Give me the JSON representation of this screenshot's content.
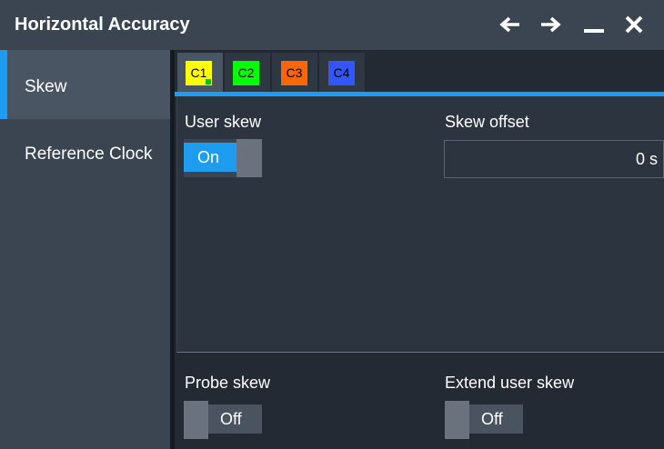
{
  "window": {
    "title": "Horizontal Accuracy",
    "icons": [
      "arrow-left-icon",
      "arrow-right-icon",
      "minimize-icon",
      "close-icon"
    ]
  },
  "sidebar": {
    "items": [
      {
        "label": "Skew",
        "selected": true
      },
      {
        "label": "Reference Clock",
        "selected": false
      }
    ]
  },
  "channel_tabs": [
    {
      "label": "C1",
      "color": "#ffff00",
      "active": true
    },
    {
      "label": "C2",
      "color": "#00ff00",
      "active": false
    },
    {
      "label": "C3",
      "color": "#ff6600",
      "active": false
    },
    {
      "label": "C4",
      "color": "#3355ff",
      "active": false
    }
  ],
  "skew_panel": {
    "user_skew_label": "User skew",
    "user_skew_state": "On",
    "skew_offset_label": "Skew offset",
    "skew_offset_value": "0 s"
  },
  "bottom": {
    "probe_skew_label": "Probe skew",
    "probe_skew_state": "Off",
    "extend_user_skew_label": "Extend user skew",
    "extend_user_skew_state": "Off"
  },
  "colors": {
    "accent": "#1e9cf0",
    "background": "#232a33",
    "titlebar": "#3b4551"
  }
}
